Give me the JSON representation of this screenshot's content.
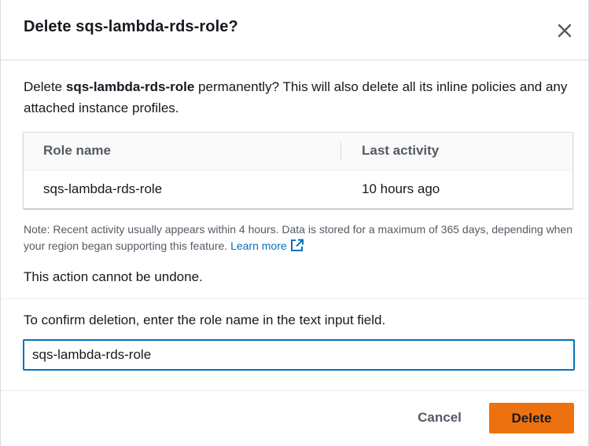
{
  "dialog": {
    "title": "Delete sqs-lambda-rds-role?",
    "close_icon": "close-icon"
  },
  "body": {
    "prefix": "Delete ",
    "role_name": "sqs-lambda-rds-role",
    "suffix": " permanently? This will also delete all its inline policies and any attached instance profiles."
  },
  "table": {
    "headers": [
      "Role name",
      "Last activity"
    ],
    "rows": [
      {
        "role_name": "sqs-lambda-rds-role",
        "last_activity": "10 hours ago"
      }
    ]
  },
  "note": {
    "text": "Note: Recent activity usually appears within 4 hours. Data is stored for a maximum of 365 days, depending when your region began supporting this feature. ",
    "link_label": "Learn more",
    "link_icon": "external-link-icon"
  },
  "warning": "This action cannot be undone.",
  "confirm": {
    "label": "To confirm deletion, enter the role name in the text input field.",
    "value": "sqs-lambda-rds-role"
  },
  "footer": {
    "cancel_label": "Cancel",
    "delete_label": "Delete"
  },
  "colors": {
    "accent": "#0073bb",
    "primary_button": "#ec7211",
    "text": "#16191f",
    "secondary_text": "#545b64"
  }
}
